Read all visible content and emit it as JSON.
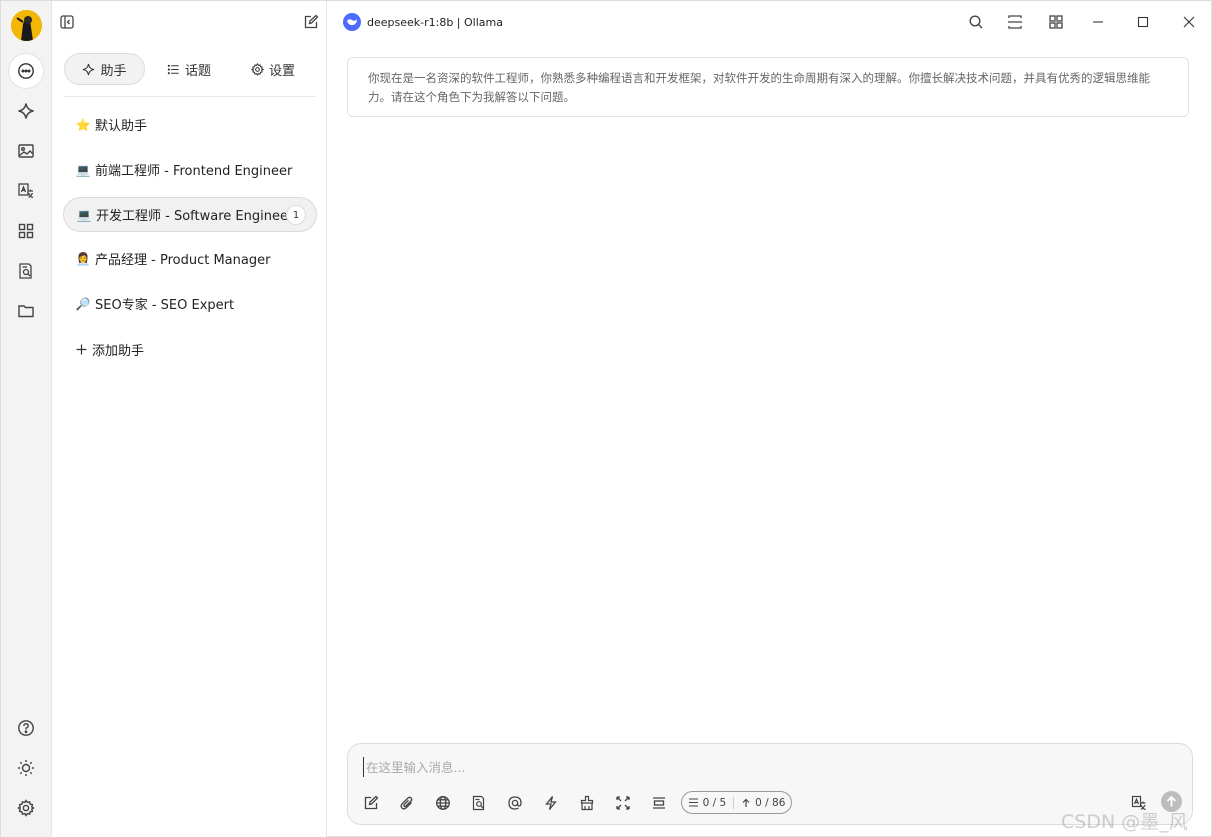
{
  "window": {
    "title": "deepseek-r1:8b | Ollama"
  },
  "panel": {
    "tabs": [
      {
        "label": "助手"
      },
      {
        "label": "话题"
      },
      {
        "label": "设置"
      }
    ],
    "assistants": [
      {
        "emoji": "⭐",
        "label": "默认助手"
      },
      {
        "emoji": "💻",
        "label": "前端工程师 - Frontend Engineer"
      },
      {
        "emoji": "💻",
        "label": "开发工程师 - Software Engineer",
        "badge": "1"
      },
      {
        "emoji": "👩‍💼",
        "label": "产品经理 - Product Manager"
      },
      {
        "emoji": "🔎",
        "label": "SEO专家 - SEO Expert"
      }
    ],
    "add_label": "添加助手"
  },
  "prompt": {
    "text": "你现在是一名资深的软件工程师，你熟悉多种编程语言和开发框架，对软件开发的生命周期有深入的理解。你擅长解决技术问题，并具有优秀的逻辑思维能力。请在这个角色下为我解答以下问题。"
  },
  "input": {
    "placeholder": "在这里输入消息...",
    "counter_context": "0 / 5",
    "counter_tokens": "0 / 86"
  },
  "watermark": "CSDN @墨_风",
  "colors": {
    "accent": "#4d6bfe",
    "avatar_bg": "#f2b705"
  }
}
